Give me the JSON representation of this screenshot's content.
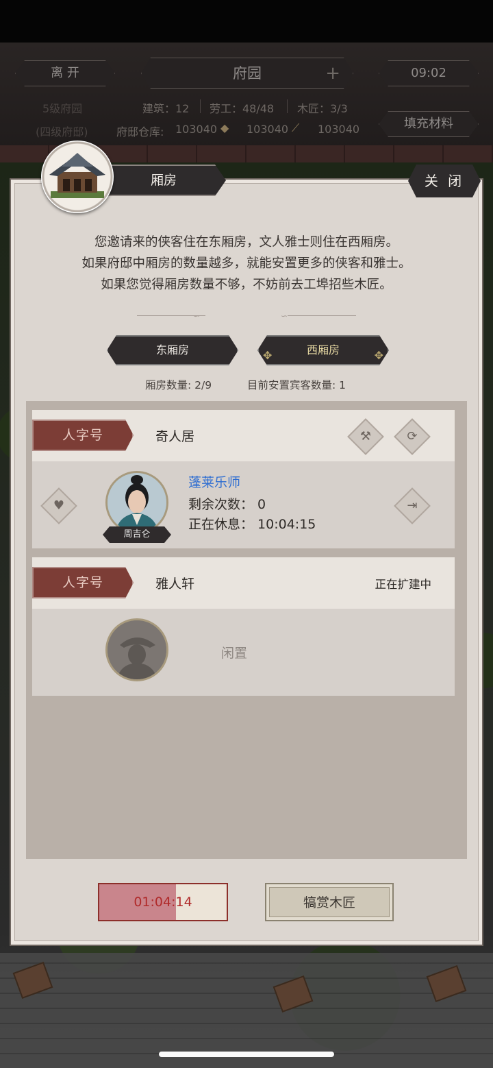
{
  "hud": {
    "leave_label": "离 开",
    "location_title": "府园",
    "time": "09:02",
    "estate_level": "5级府园",
    "estate_type": "(四级府邸)",
    "buildings": "建筑：12",
    "laborers": "劳工：48/48",
    "carpenters": "木匠：3/3",
    "warehouse_label": "府邸仓库:",
    "resources": [
      "103040",
      "103040",
      "103040"
    ],
    "fill_materials_label": "填充材料"
  },
  "panel": {
    "title": "厢房",
    "close_label": "关 闭",
    "description": [
      "您邀请来的侠客住在东厢房，文人雅士则住在西厢房。",
      "如果府邸中厢房的数量越多，就能安置更多的侠客和雅士。",
      "如果您觉得厢房数量不够，不妨前去工埠招些木匠。"
    ],
    "tabs": {
      "east": "东厢房",
      "west": "西厢房"
    },
    "room_count": "厢房数量: 2/9",
    "guest_count": "目前安置宾客数量: 1",
    "rooms": [
      {
        "rank": "人字号",
        "name": "奇人居",
        "guest_name": "周吉仑",
        "guest_title": "蓬莱乐师",
        "remaining": "剩余次数：  0",
        "resting": "正在休息：  10:04:15"
      },
      {
        "rank": "人字号",
        "name": "雅人轩",
        "status": "正在扩建中",
        "idle_label": "闲置"
      }
    ],
    "timer": {
      "value": "01:04:14",
      "progress": 0.6
    },
    "reward_label": "犒赏木匠"
  }
}
